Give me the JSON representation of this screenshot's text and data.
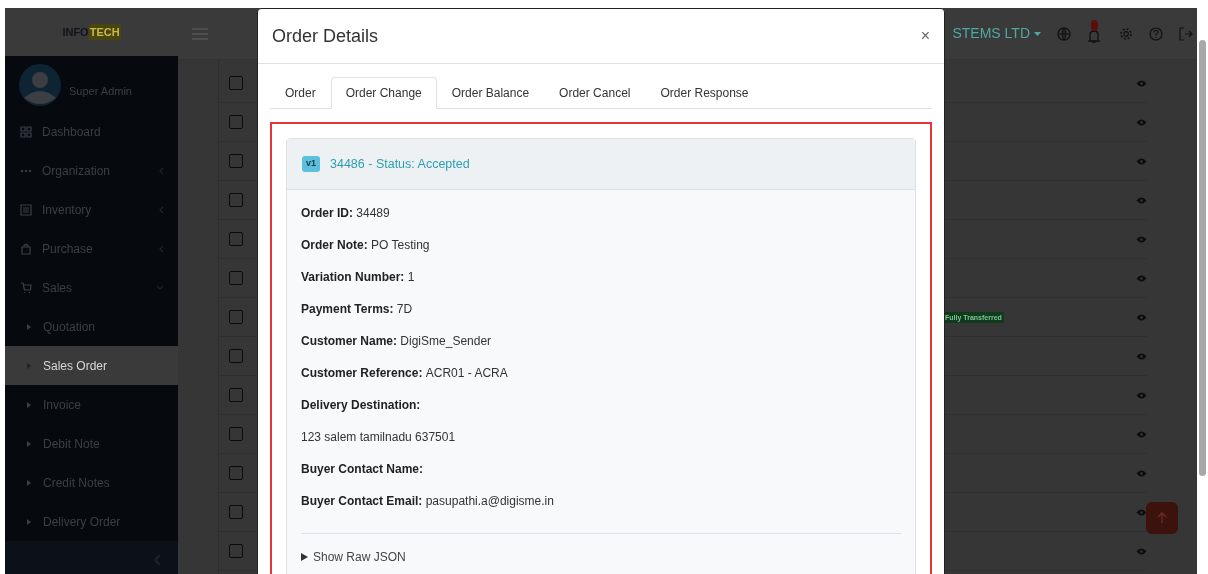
{
  "header": {
    "logo": {
      "left": "INFO",
      "right": "TECH"
    },
    "company": "STEMS LTD"
  },
  "sidebar": {
    "user": "Super Admin",
    "items": [
      {
        "label": "Dashboard",
        "kind": "link"
      },
      {
        "label": "Organization",
        "kind": "group",
        "expanded": false
      },
      {
        "label": "Inventory",
        "kind": "group",
        "expanded": false
      },
      {
        "label": "Purchase",
        "kind": "group",
        "expanded": false
      },
      {
        "label": "Sales",
        "kind": "group",
        "expanded": true,
        "children": [
          {
            "label": "Quotation",
            "selected": false
          },
          {
            "label": "Sales Order",
            "selected": true
          },
          {
            "label": "Invoice",
            "selected": false
          },
          {
            "label": "Debit Note",
            "selected": false
          },
          {
            "label": "Credit Notes",
            "selected": false
          },
          {
            "label": "Delivery Order",
            "selected": false
          }
        ]
      }
    ]
  },
  "table": {
    "rows": [
      {
        "checked": false
      },
      {
        "checked": false
      },
      {
        "checked": false
      },
      {
        "checked": false
      },
      {
        "checked": false
      },
      {
        "checked": false
      },
      {
        "checked": false,
        "status": "Fully Transferred"
      },
      {
        "checked": false
      },
      {
        "checked": false
      },
      {
        "checked": false
      },
      {
        "checked": false
      },
      {
        "checked": false
      },
      {
        "checked": false
      }
    ]
  },
  "modal": {
    "title": "Order Details",
    "close": "×",
    "tabs": [
      {
        "label": "Order",
        "selected": false
      },
      {
        "label": "Order Change",
        "selected": true
      },
      {
        "label": "Order Balance",
        "selected": false
      },
      {
        "label": "Order Cancel",
        "selected": false
      },
      {
        "label": "Order Response",
        "selected": false
      }
    ],
    "card": {
      "version": "v1",
      "title": "34486 - Status: Accepted",
      "fields": [
        {
          "kind": "pair",
          "label": "Order ID:",
          "value": "34489"
        },
        {
          "kind": "pair",
          "label": "Order Note:",
          "value": "PO Testing"
        },
        {
          "kind": "pair",
          "label": "Variation Number:",
          "value": "1"
        },
        {
          "kind": "pair",
          "label": "Payment Terms:",
          "value": "7D"
        },
        {
          "kind": "pair",
          "label": "Customer Name:",
          "value": "DigiSme_Sender"
        },
        {
          "kind": "pair",
          "label": "Customer Reference:",
          "value": "ACR01 - ACRA"
        },
        {
          "kind": "pair",
          "label": "Delivery Destination:"
        },
        {
          "kind": "text",
          "value": "123 salem tamilnadu 637501"
        },
        {
          "kind": "pair",
          "label": "Buyer Contact Name:"
        },
        {
          "kind": "pair",
          "label": "Buyer Contact Email:",
          "value": "pasupathi.a@digisme.in"
        }
      ],
      "raw_toggle": {
        "label": "Show Raw JSON",
        "expanded": false
      }
    }
  }
}
